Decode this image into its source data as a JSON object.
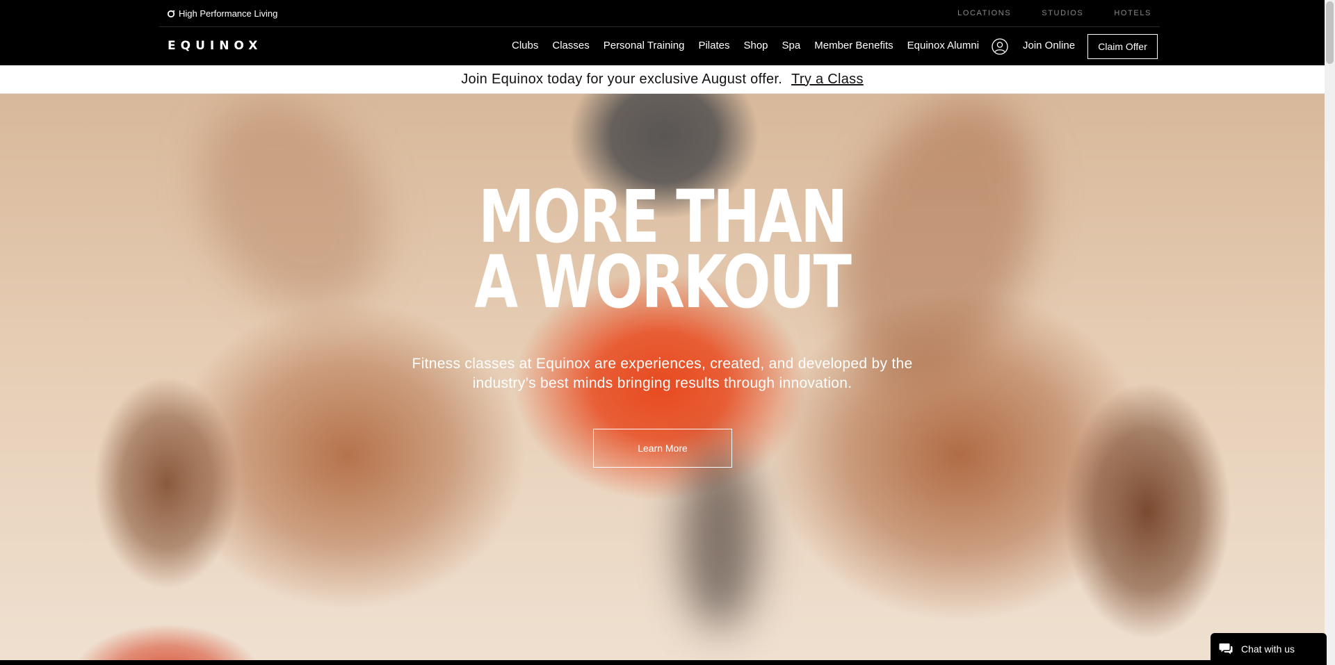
{
  "utility_bar": {
    "tagline": "High Performance Living",
    "links": [
      "LOCATIONS",
      "STUDIOS",
      "HOTELS"
    ]
  },
  "nav": {
    "logo": "EQUINOX",
    "links": [
      "Clubs",
      "Classes",
      "Personal Training",
      "Pilates",
      "Shop",
      "Spa",
      "Member Benefits",
      "Equinox Alumni"
    ],
    "account_icon": "user-circle-icon",
    "join_online": "Join Online",
    "claim_offer": "Claim Offer"
  },
  "promo": {
    "text": "Join Equinox today for your exclusive August offer.",
    "link": "Try a Class"
  },
  "hero": {
    "headline_line1": "MORE THAN",
    "headline_line2": "A WORKOUT",
    "subtitle_line1": "Fitness classes at Equinox are experiences, created, and developed by the",
    "subtitle_line2": "industry’s best minds bringing results through innovation.",
    "cta": "Learn More"
  },
  "chat": {
    "label": "Chat with us",
    "icon": "chat-bubble-icon"
  },
  "colors": {
    "background": "#000000",
    "promo_background": "#ffffff",
    "text_light": "#ffffff",
    "utility_link": "#8a8a8a",
    "hero_accent": "#e84a1f"
  }
}
